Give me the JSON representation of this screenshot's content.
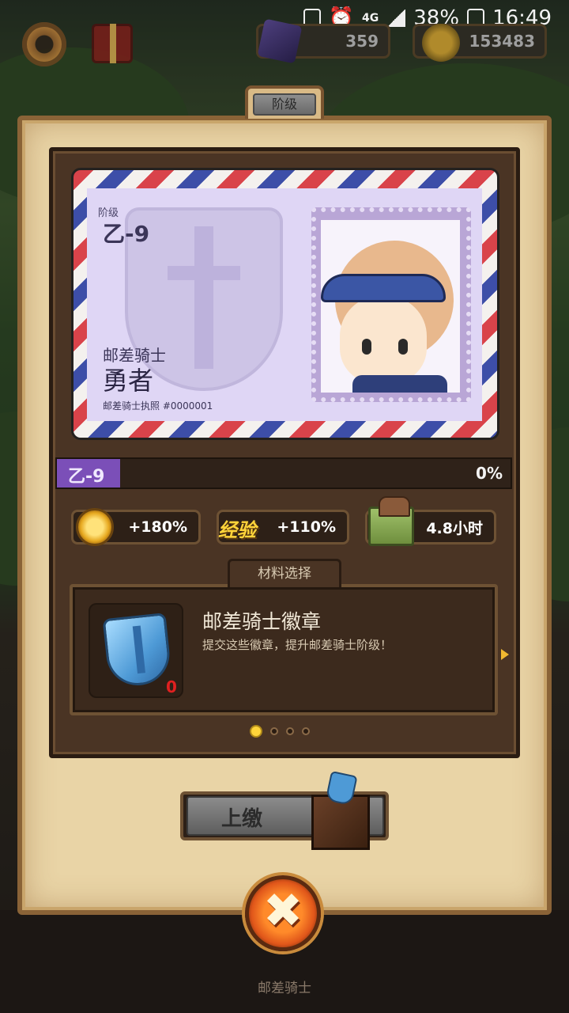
{
  "status_bar": {
    "network": "4G",
    "battery": "38%",
    "time": "16:49"
  },
  "hud": {
    "gems": "359",
    "coins": "153483"
  },
  "panel": {
    "tab_label": "阶级"
  },
  "card": {
    "grade_label": "阶级",
    "grade_value": "乙-9",
    "title_small": "邮差骑士",
    "title_big": "勇者",
    "license": "邮差骑士执照 #0000001"
  },
  "progress": {
    "grade": "乙-9",
    "percent_text": "0%",
    "fraction": 0.14
  },
  "bonuses": [
    {
      "icon": "coin-icon",
      "text": "+180%"
    },
    {
      "icon": "exp-icon",
      "label": "经验",
      "text": "+110%"
    },
    {
      "icon": "crate-icon",
      "text": "4.8小时"
    }
  ],
  "material": {
    "tab_label": "材料选择",
    "name": "邮差骑士徽章",
    "description": "提交这些徽章，提升邮差骑士阶级！",
    "count": "0",
    "pages": 4,
    "active_page": 1
  },
  "submit_label": "上缴",
  "footer_label": "邮差骑士",
  "colors": {
    "accent_purple": "#7b4fb8",
    "gold": "#ffd43a",
    "close_orange": "#e0561a"
  }
}
